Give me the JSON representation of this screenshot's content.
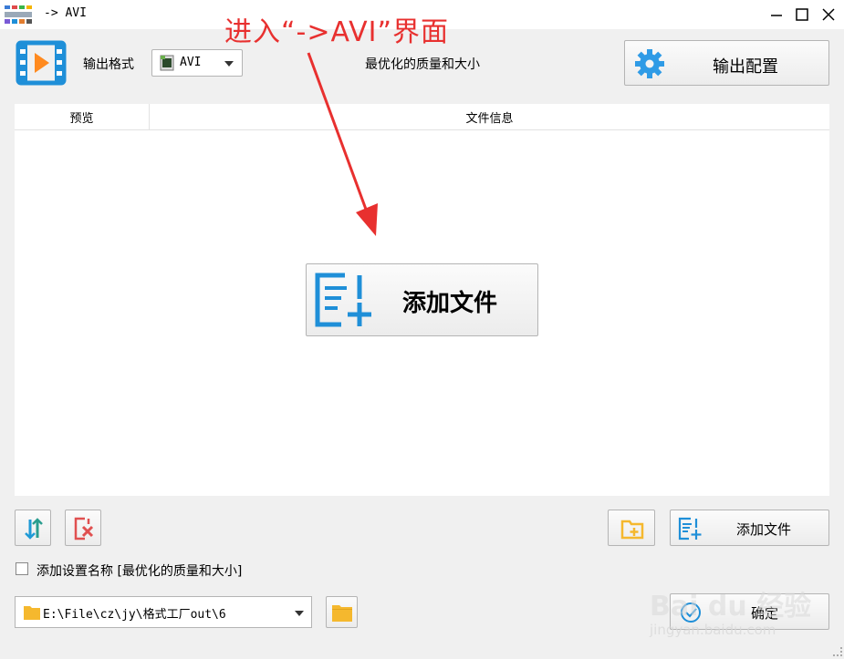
{
  "window": {
    "title": "-> AVI"
  },
  "toolbar": {
    "format_label": "输出格式",
    "format_value": "AVI",
    "quality_text": "最优化的质量和大小",
    "output_config_label": "输出配置"
  },
  "file_list": {
    "columns": [
      "预览",
      "文件信息"
    ],
    "add_file_center_label": "添加文件"
  },
  "bottom": {
    "add_file_label": "添加文件",
    "checkbox_label": "添加设置名称 [最优化的质量和大小]",
    "checkbox_checked": false,
    "output_path": "E:\\File\\cz\\jy\\格式工厂out\\6",
    "ok_label": "确定"
  },
  "annotation": {
    "text": "进入“->AVI”界面"
  },
  "watermark": {
    "brand": "Bai du 经验",
    "url": "jingyan.baidu.com"
  },
  "colors": {
    "accent_blue": "#1f8fd8",
    "annotation_red": "#e8302f",
    "folder_yellow": "#f5b82e",
    "delete_red": "#e05050"
  }
}
